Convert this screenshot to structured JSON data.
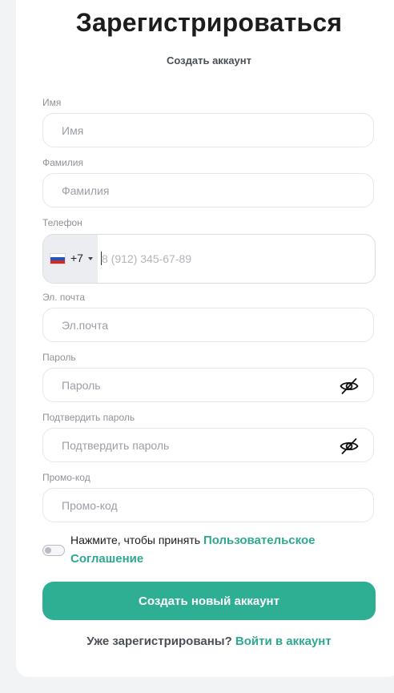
{
  "header": {
    "title": "Зарегистрироваться",
    "subtitle": "Создать аккаунт"
  },
  "form": {
    "first_name": {
      "label": "Имя",
      "placeholder": "Имя",
      "value": ""
    },
    "last_name": {
      "label": "Фамилия",
      "placeholder": "Фамилия",
      "value": ""
    },
    "phone": {
      "label": "Телефон",
      "country_code": "+7",
      "placeholder": "8 (912) 345-67-89",
      "flag": "russia-flag-icon"
    },
    "email": {
      "label": "Эл. почта",
      "placeholder": "Эл.почта",
      "value": ""
    },
    "password": {
      "label": "Пароль",
      "placeholder": "Пароль",
      "value": "",
      "icon": "eye-off-icon"
    },
    "confirm_password": {
      "label": "Подтвердить пароль",
      "placeholder": "Подтвердить пароль",
      "value": "",
      "icon": "eye-off-icon"
    },
    "promo": {
      "label": "Промо-код",
      "placeholder": "Промо-код",
      "value": ""
    },
    "agreement": {
      "text": "Нажмите, чтобы принять",
      "link": "Пользовательское Соглашение",
      "checked": false
    },
    "submit_label": "Создать новый аккаунт"
  },
  "footer": {
    "text": "Уже зарегистрированы?",
    "link": "Войти в аккаунт"
  },
  "colors": {
    "accent": "#2eae93",
    "link": "#2ea98f",
    "background": "#f2f3f5"
  }
}
